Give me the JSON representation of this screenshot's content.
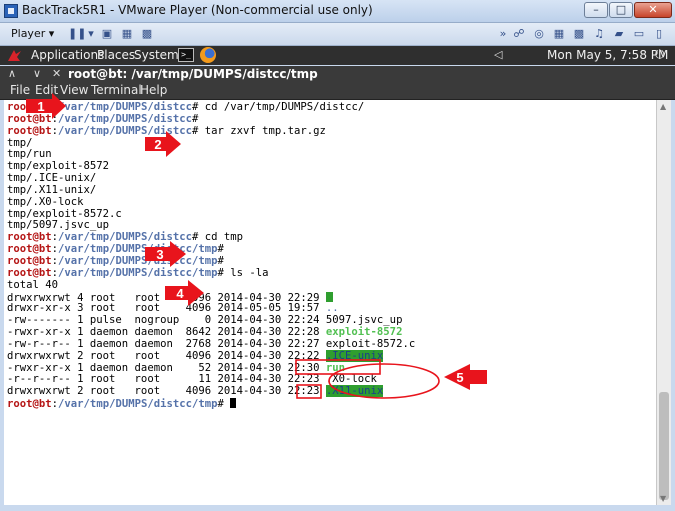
{
  "vm_window": {
    "title": "BackTrack5R1 - VMware Player (Non-commercial use only)",
    "min_glyph": "–",
    "max_glyph": "□",
    "close_glyph": "✕"
  },
  "vm_toolbar": {
    "player_label": "Player ▾",
    "icons": [
      "pause-icon",
      "send-keys-icon",
      "fit-guest-icon",
      "unity-icon",
      "forward-icon",
      "device-icons"
    ]
  },
  "gnome_panel": {
    "menus": [
      "Applications",
      "Places",
      "System"
    ],
    "terminal_glyph": ">_",
    "clock": "Mon May  5,  7:58 PM"
  },
  "terminal_window": {
    "title": "root@bt: /var/tmp/DUMPS/distcc/tmp",
    "menu": [
      "File",
      "Edit",
      "View",
      "Terminal",
      "Help"
    ]
  },
  "terminal_lines": [
    {
      "user": "root@bt",
      "path": "/var/tmp/DUMPS/distcc",
      "cmd": " cd /var/tmp/DUMPS/distcc/"
    },
    {
      "user": "root@bt",
      "path": "/var/tmp/DUMPS/distcc",
      "cmd": ""
    },
    {
      "user": "root@bt",
      "path": "/var/tmp/DUMPS/distcc",
      "cmd": " tar zxvf tmp.tar.gz"
    },
    {
      "text": "tmp/"
    },
    {
      "text": "tmp/run"
    },
    {
      "text": "tmp/exploit-8572"
    },
    {
      "text": "tmp/.ICE-unix/"
    },
    {
      "text": "tmp/.X11-unix/"
    },
    {
      "text": "tmp/.X0-lock"
    },
    {
      "text": "tmp/exploit-8572.c"
    },
    {
      "text": "tmp/5097.jsvc_up"
    },
    {
      "user": "root@bt",
      "path": "/var/tmp/DUMPS/distcc",
      "cmd": " cd tmp"
    },
    {
      "user": "root@bt",
      "path": "/var/tmp/DUMPS/distcc/tmp",
      "cmd": ""
    },
    {
      "user": "root@bt",
      "path": "/var/tmp/DUMPS/distcc/tmp",
      "cmd": ""
    },
    {
      "user": "root@bt",
      "path": "/var/tmp/DUMPS/distcc/tmp",
      "cmd": " ls -la"
    },
    {
      "text": "total 40"
    },
    {
      "perm": "drwxrwxrwt 4 root   root    4096 2014-04-30 22:29 ",
      "name": "",
      "style": "dirhl"
    },
    {
      "perm": "drwxr-xr-x 3 root   root    4096 2014-05-05 19:57 ",
      "name": "..",
      "style": "dir"
    },
    {
      "perm": "-rw------- 1 pulse  nogroup    0 2014-04-30 22:24 ",
      "name": "5097.jsvc_up",
      "style": "plain"
    },
    {
      "perm": "-rwxr-xr-x 1 daemon daemon  8642 2014-04-30 22:28 ",
      "name": "exploit-8572",
      "style": "exec"
    },
    {
      "perm": "-rw-r--r-- 1 daemon daemon  2768 2014-04-30 22:27 ",
      "name": "exploit-8572.c",
      "style": "plain"
    },
    {
      "perm": "drwxrwxrwt 2 root   root    4096 2014-04-30 22:22 ",
      "name": ".ICE-unix",
      "style": "dirhl"
    },
    {
      "perm": "-rwxr-xr-x 1 daemon daemon    52 2014-04-30 22:30 ",
      "name": "run",
      "style": "exec"
    },
    {
      "perm": "-r--r--r-- 1 root   root      11 2014-04-30 22:23 ",
      "name": ".X0-lock",
      "style": "plain"
    },
    {
      "perm": "drwxrwxrwt 2 root   root    4096 2014-04-30 22:23 ",
      "name": ".X11-unix",
      "style": "dirhl"
    },
    {
      "user": "root@bt",
      "path": "/var/tmp/DUMPS/distcc/tmp",
      "cmd": " ",
      "cursor": true
    }
  ],
  "annotations": [
    {
      "label": "1"
    },
    {
      "label": "2"
    },
    {
      "label": "3"
    },
    {
      "label": "4"
    },
    {
      "label": "5"
    }
  ],
  "colors": {
    "prompt_user": "#b51515",
    "prompt_path": "#5572a9",
    "exec_green": "#52c052",
    "dir_highlight": "#2f9e2f",
    "annotation_red": "#e8141c"
  }
}
